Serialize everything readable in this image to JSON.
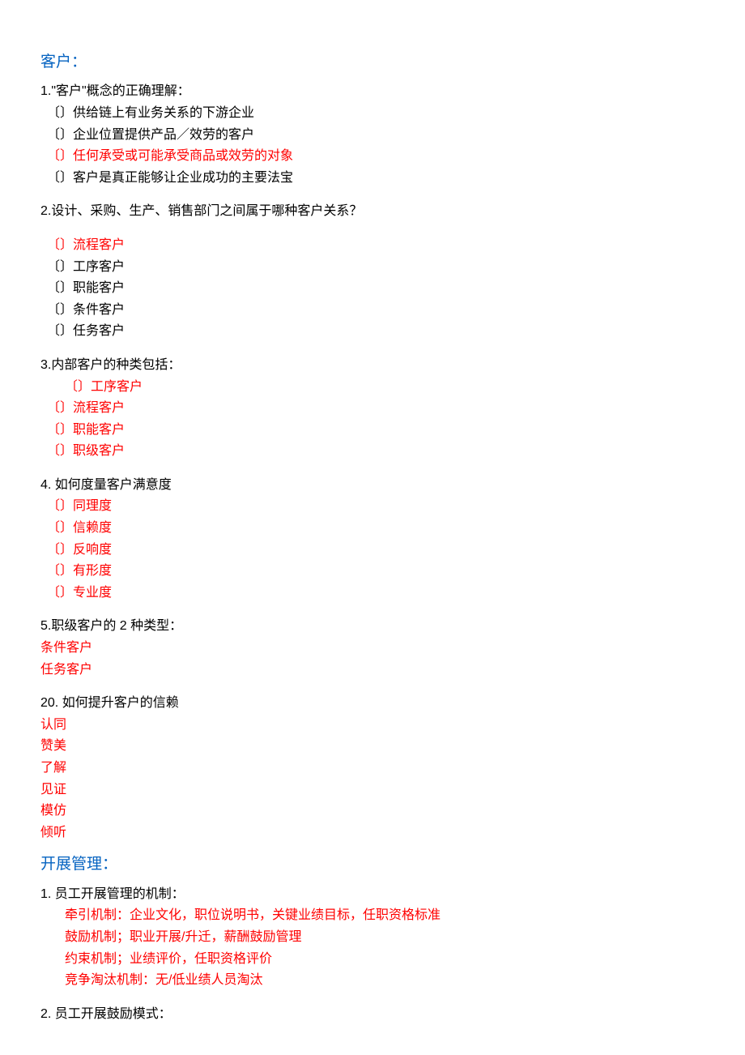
{
  "section1": {
    "heading": "客户：",
    "q1": {
      "title": "1.\"客户\"概念的正确理解：",
      "opts": [
        {
          "t": "〔〕供给链上有业务关系的下游企业",
          "c": "black"
        },
        {
          "t": "〔〕企业位置提供产品／效劳的客户",
          "c": "black"
        },
        {
          "t": "〔〕任何承受或可能承受商品或效劳的对象",
          "c": "red"
        },
        {
          "t": "〔〕客户是真正能够让企业成功的主要法宝",
          "c": "black"
        }
      ]
    },
    "q2": {
      "title": "2.设计、采购、生产、销售部门之间属于哪种客户关系？",
      "opts": [
        {
          "t": "〔〕流程客户",
          "c": "red"
        },
        {
          "t": "〔〕工序客户",
          "c": "black"
        },
        {
          "t": "〔〕职能客户",
          "c": "black"
        },
        {
          "t": "〔〕条件客户",
          "c": "black"
        },
        {
          "t": "〔〕任务客户",
          "c": "black"
        }
      ]
    },
    "q3": {
      "title": "3.内部客户的种类包括：",
      "opts": [
        {
          "t": "〔〕工序客户",
          "c": "red",
          "indent": "indent2"
        },
        {
          "t": "〔〕流程客户",
          "c": "red",
          "indent": "indent1"
        },
        {
          "t": "〔〕职能客户",
          "c": "red",
          "indent": "indent1"
        },
        {
          "t": "〔〕职级客户",
          "c": "red",
          "indent": "indent1"
        }
      ]
    },
    "q4": {
      "title": "4.  如何度量客户满意度",
      "opts": [
        {
          "t": "〔〕同理度",
          "c": "red"
        },
        {
          "t": "〔〕信赖度",
          "c": "red"
        },
        {
          "t": "〔〕反响度",
          "c": "red"
        },
        {
          "t": "〔〕有形度",
          "c": "red"
        },
        {
          "t": "〔〕专业度",
          "c": "red"
        }
      ]
    },
    "q5": {
      "title": "5.职级客户的 2 种类型：",
      "opts": [
        {
          "t": "条件客户",
          "c": "red"
        },
        {
          "t": "任务客户",
          "c": "red"
        }
      ]
    },
    "q20": {
      "title": "20.   如何提升客户的信赖",
      "opts": [
        {
          "t": "认同",
          "c": "red"
        },
        {
          "t": "赞美",
          "c": "red"
        },
        {
          "t": "了解",
          "c": "red"
        },
        {
          "t": "见证",
          "c": "red"
        },
        {
          "t": "模仿",
          "c": "red"
        },
        {
          "t": "倾听",
          "c": "red"
        }
      ]
    }
  },
  "section2": {
    "heading": "开展管理：",
    "q1": {
      "title": "1.    员工开展管理的机制：",
      "opts": [
        {
          "t": "牵引机制：企业文化，职位说明书，关键业绩目标，任职资格标准",
          "c": "red"
        },
        {
          "t": "鼓励机制；职业开展/升迁，薪酬鼓励管理",
          "c": "red"
        },
        {
          "t": "约束机制；业绩评价，任职资格评价",
          "c": "red"
        },
        {
          "t": "竞争淘汰机制：无/低业绩人员淘汰",
          "c": "red"
        }
      ]
    },
    "q2": {
      "title": "2.    员工开展鼓励模式："
    }
  }
}
